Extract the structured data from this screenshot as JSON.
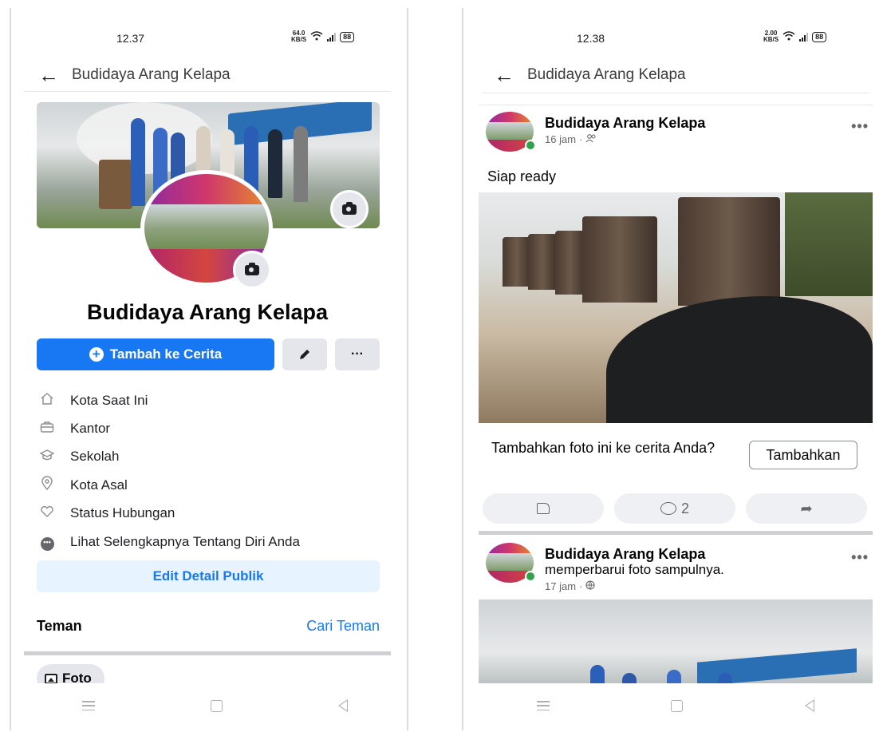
{
  "left": {
    "status": {
      "time": "12.37",
      "speed": "64.0",
      "speed_unit": "KB/S",
      "battery": "88"
    },
    "header": {
      "title": "Budidaya Arang Kelapa"
    },
    "cover_image": "cover-photo",
    "profile": {
      "name": "Budidaya Arang Kelapa",
      "add_story_label": "Tambah ke Cerita",
      "more_label": "···"
    },
    "about": [
      {
        "icon": "home-icon",
        "label": "Kota Saat Ini"
      },
      {
        "icon": "briefcase-icon",
        "label": "Kantor"
      },
      {
        "icon": "graduation-cap-icon",
        "label": "Sekolah"
      },
      {
        "icon": "location-pin-icon",
        "label": "Kota Asal"
      },
      {
        "icon": "heart-icon",
        "label": "Status Hubungan"
      },
      {
        "icon": "more-dots-icon",
        "label": "Lihat Selengkapnya Tentang Diri Anda"
      }
    ],
    "edit_public_label": "Edit Detail Publik",
    "friends": {
      "title": "Teman",
      "find_label": "Cari Teman"
    },
    "photo_chip": "Foto"
  },
  "right": {
    "status": {
      "time": "12.38",
      "speed": "2.00",
      "speed_unit": "KB/S",
      "battery": "88"
    },
    "header": {
      "title": "Budidaya Arang Kelapa"
    },
    "post1": {
      "author": "Budidaya Arang Kelapa",
      "time": "16 jam",
      "privacy_icon": "friends-icon",
      "text": "Siap ready",
      "prompt": "Tambahkan foto ini ke cerita Anda?",
      "prompt_button": "Tambahkan",
      "comment_count": "2"
    },
    "post2": {
      "author": "Budidaya Arang Kelapa",
      "action": "memperbarui foto sampulnya.",
      "time": "17 jam",
      "privacy_icon": "globe-icon"
    }
  },
  "colors": {
    "accent": "#1877f2",
    "accent_light": "#e7f3ff",
    "online": "#31a24c"
  }
}
